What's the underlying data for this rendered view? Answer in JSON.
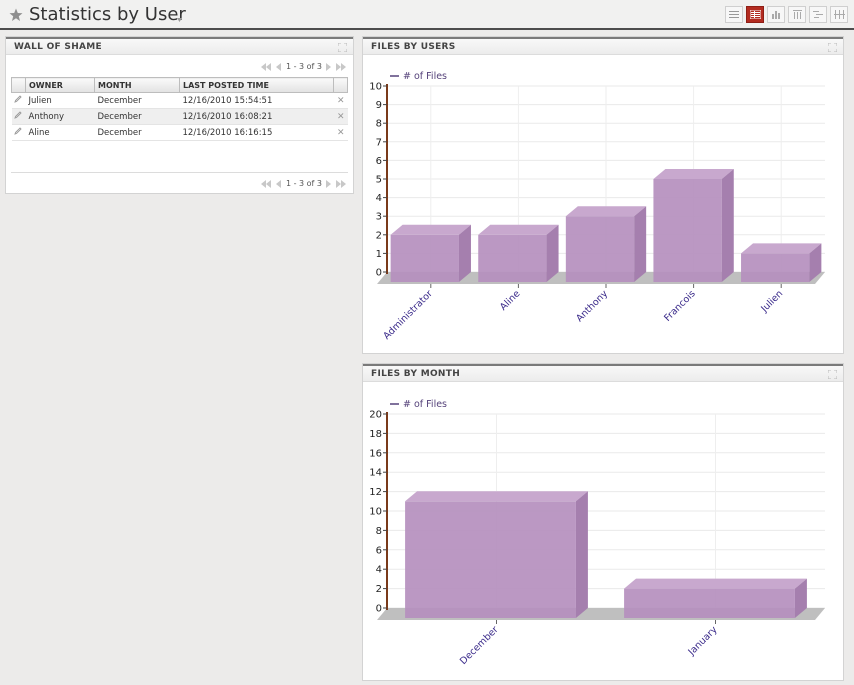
{
  "header": {
    "title": "Statistics by User",
    "view_buttons": [
      "list-view-icon",
      "table-view-icon",
      "bar-chart-view-icon",
      "column-view-icon",
      "gantt-view-icon",
      "grid-view-icon"
    ],
    "active_view": "table-view-icon"
  },
  "wall_of_shame": {
    "title": "WALL OF SHAME",
    "pager_text": "1 - 3 of 3",
    "columns": [
      "OWNER",
      "MONTH",
      "LAST POSTED TIME"
    ],
    "rows": [
      {
        "owner": "Julien",
        "month": "December",
        "time": "12/16/2010 15:54:51"
      },
      {
        "owner": "Anthony",
        "month": "December",
        "time": "12/16/2010 16:08:21"
      },
      {
        "owner": "Aline",
        "month": "December",
        "time": "12/16/2010 16:16:15"
      }
    ]
  },
  "files_by_users": {
    "title": "FILES BY USERS"
  },
  "files_by_month": {
    "title": "FILES BY MONTH"
  },
  "colors": {
    "bar": "#b58fbe",
    "accent_red": "#b32b20",
    "axis": "#7a3a1a"
  },
  "chart_data": [
    {
      "type": "bar",
      "title": "FILES BY USERS",
      "categories": [
        "Administrator",
        "Aline",
        "Anthony",
        "Francois",
        "Julien"
      ],
      "series": [
        {
          "name": "# of Files",
          "values": [
            2,
            2,
            3,
            5,
            1
          ]
        }
      ],
      "ylim": [
        0,
        10
      ],
      "yticks": [
        0,
        1,
        2,
        3,
        4,
        5,
        6,
        7,
        8,
        9,
        10
      ],
      "grid": true,
      "legend": "top-left"
    },
    {
      "type": "bar",
      "title": "FILES BY MONTH",
      "categories": [
        "December",
        "January"
      ],
      "series": [
        {
          "name": "# of Files",
          "values": [
            11,
            2
          ]
        }
      ],
      "ylim": [
        0,
        20
      ],
      "yticks": [
        0,
        2,
        4,
        6,
        8,
        10,
        12,
        14,
        16,
        18,
        20
      ],
      "grid": true,
      "legend": "top-left"
    }
  ]
}
